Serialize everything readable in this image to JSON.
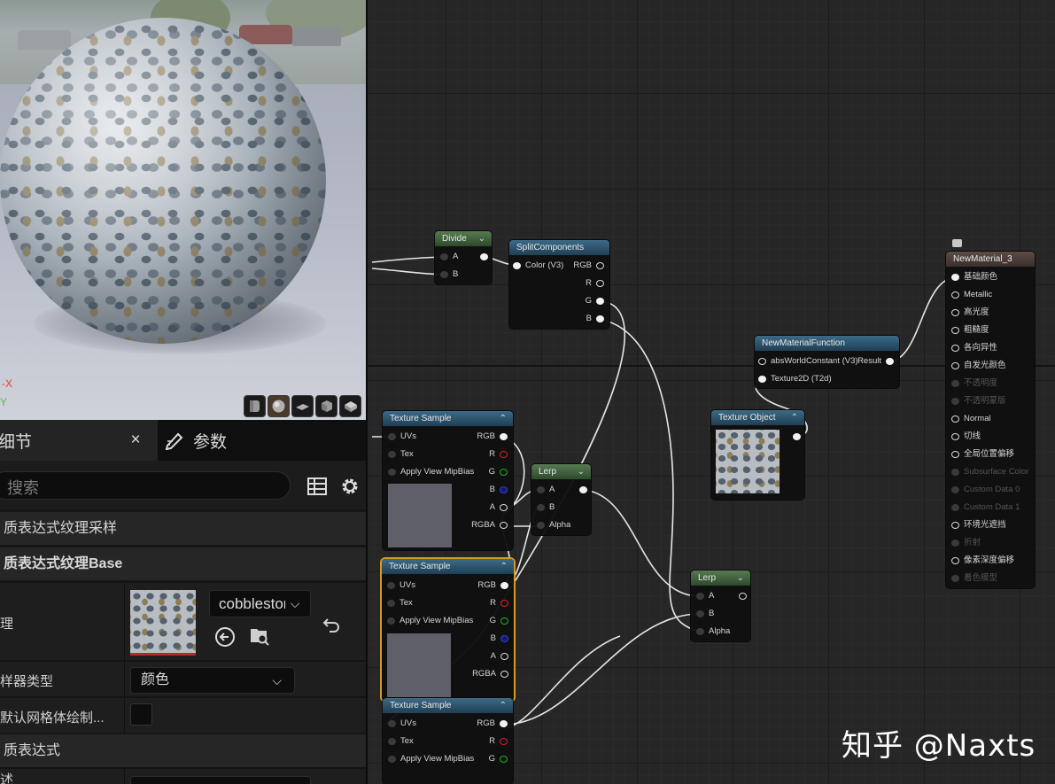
{
  "viewport": {
    "axis_x": "-X",
    "axis_y": "Y",
    "toolbar_icons": [
      "cylinder-preview-icon",
      "sphere-preview-icon",
      "plane-preview-icon",
      "cube-preview-icon",
      "custom-mesh-preview-icon"
    ]
  },
  "details": {
    "tab_details": "细节",
    "tab_close": "×",
    "tab_params": "参数",
    "search_placeholder": "搜索",
    "category_1": "质表达式纹理采样",
    "category_2": "质表达式纹理Base",
    "texture_label": "理",
    "texture_asset": "cobblestone",
    "sampler_label": "样器类型",
    "sampler_value": "颜色",
    "default_mesh_label": "默认网格体绘制...",
    "category_3": "质表达式",
    "last_label": "述"
  },
  "graph": {
    "divide": {
      "title": "Divide",
      "in_a": "A",
      "in_b": "B"
    },
    "split": {
      "title": "SplitComponents",
      "in_color": "Color (V3)",
      "out_rgb": "RGB",
      "out_r": "R",
      "out_g": "G",
      "out_b": "B"
    },
    "func": {
      "title": "NewMaterialFunction",
      "in_abs": "absWorldConstant (V3)",
      "out_result": "Result",
      "in_tex": "Texture2D (T2d)"
    },
    "tex_obj": {
      "title": "Texture Object"
    },
    "ts1": {
      "title": "Texture Sample",
      "uvs": "UVs",
      "tex": "Tex",
      "mip": "Apply View MipBias",
      "rgb": "RGB",
      "r": "R",
      "g": "G",
      "b": "B",
      "a": "A",
      "rgba": "RGBA"
    },
    "ts2": {
      "title": "Texture Sample",
      "uvs": "UVs",
      "tex": "Tex",
      "mip": "Apply View MipBias",
      "rgb": "RGB",
      "r": "R",
      "g": "G",
      "b": "B",
      "a": "A",
      "rgba": "RGBA"
    },
    "ts3": {
      "title": "Texture Sample",
      "uvs": "UVs",
      "tex": "Tex",
      "mip": "Apply View MipBias",
      "rgb": "RGB",
      "r": "R",
      "g": "G"
    },
    "lerp1": {
      "title": "Lerp",
      "a": "A",
      "b": "B",
      "alpha": "Alpha"
    },
    "lerp2": {
      "title": "Lerp",
      "a": "A",
      "b": "B",
      "alpha": "Alpha"
    },
    "material": {
      "title": "NewMaterial_3",
      "pins": [
        {
          "label": "基础颜色",
          "active": true
        },
        {
          "label": "Metallic",
          "active": true
        },
        {
          "label": "高光度",
          "active": true
        },
        {
          "label": "粗糙度",
          "active": true
        },
        {
          "label": "各向异性",
          "active": true
        },
        {
          "label": "自发光颜色",
          "active": true
        },
        {
          "label": "不透明度",
          "active": false
        },
        {
          "label": "不透明蒙版",
          "active": false
        },
        {
          "label": "Normal",
          "active": true
        },
        {
          "label": "切线",
          "active": true
        },
        {
          "label": "全局位置偏移",
          "active": true
        },
        {
          "label": "Subsurface Color",
          "active": false
        },
        {
          "label": "Custom Data 0",
          "active": false
        },
        {
          "label": "Custom Data 1",
          "active": false
        },
        {
          "label": "环境光遮挡",
          "active": true
        },
        {
          "label": "折射",
          "active": false
        },
        {
          "label": "像素深度偏移",
          "active": true
        },
        {
          "label": "着色模型",
          "active": false
        }
      ]
    }
  },
  "watermark": "知乎 @Naxts"
}
